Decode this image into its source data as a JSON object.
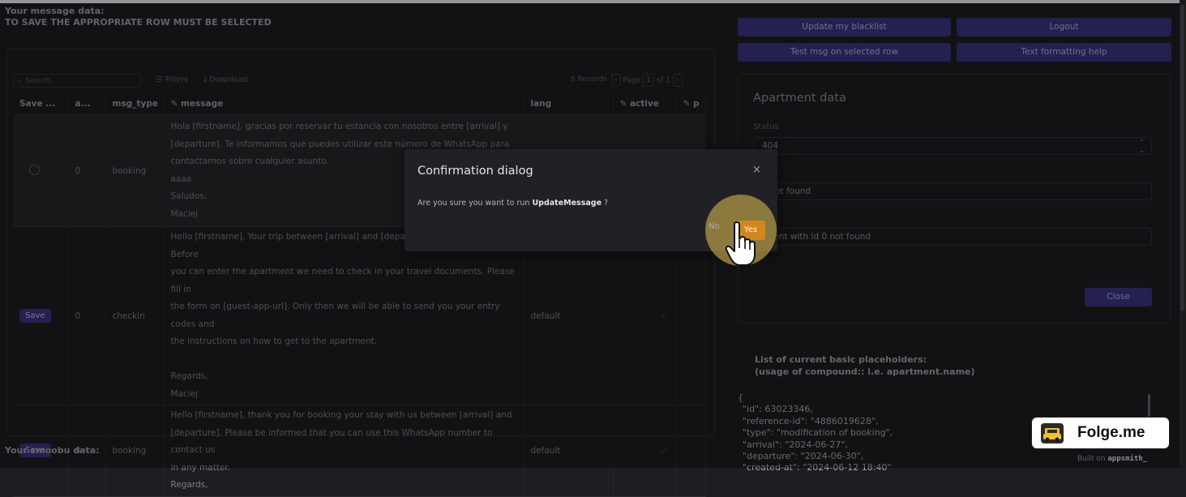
{
  "header": {
    "title": "Your message data:",
    "subtitle": "TO SAVE THE APPROPRIATE ROW MUST BE SELECTED",
    "bottom_title": "Your smoobu data:"
  },
  "table_toolbar": {
    "search_placeholder": "Search...",
    "filters": "Filters",
    "download": "Download",
    "records": "6 Records",
    "page_label": "Page",
    "page": "1",
    "of": "of 1"
  },
  "table": {
    "columns": [
      "Save ...",
      "a...",
      "msg_type",
      "message",
      "lang",
      "active",
      "p"
    ],
    "save_label": "Save",
    "rows": [
      {
        "a": "0",
        "msg_type": "booking",
        "message": [
          "Hola [firstname], gracias por reservar tu estancia con nosotros entre [arrival] y",
          "[departure]. Te informamos que puedes utilizar este número de WhatsApp para",
          "contactarnos sobre cualquier asunto.",
          "aaaa",
          "Saludos,",
          "Maciej"
        ],
        "lang": ""
      },
      {
        "a": "0",
        "msg_type": "checkin",
        "message": [
          "Hello [firstname], Your trip between [arrival] and [departure] is approaching. Before",
          "you can enter the apartment we need to check in your travel documents. Please fill in",
          "the form on [guest-app-url]. Only then we will be able to send you your entry codes and",
          "the instructions on how to get to the apartment.",
          "",
          "Regards,",
          "Maciej"
        ],
        "lang": "default"
      },
      {
        "a": "0",
        "msg_type": "booking",
        "message": [
          "Hello [firstname], thank you for booking your stay with us between [arrival] and",
          "[departure]. Please be informed that you can use this WhatsApp number to contact us",
          "in any matter.",
          "Regards,"
        ],
        "lang": "default"
      }
    ]
  },
  "buttons": {
    "update_blacklist": "Update my blacklist",
    "logout": "Logout",
    "test_msg": "Test msg on selected row",
    "text_help": "Text formatting help"
  },
  "apartment": {
    "title": "Apartment data",
    "status_label": "Status",
    "status_value": "404",
    "field2_value": "y not found",
    "field3_value": "tment with id 0 not found",
    "close": "Close"
  },
  "placeholders": {
    "title": "List of current basic placeholders:",
    "subtitle": "(usage of compound:: i.e. apartment.name)",
    "json_lines": [
      "{",
      "\"id\": 63023346,",
      "\"reference-id\": \"4886019628\",",
      "\"type\": \"modification of booking\",",
      "\"arrival\": \"2024-06-27\",",
      "\"departure\": \"2024-06-30\",",
      "\"created-at\": \"2024-06-12 18:40\""
    ]
  },
  "dialog": {
    "title": "Confirmation dialog",
    "text_prefix": "Are you sure you want to run",
    "action": "UpdateMessage",
    "text_suffix": " ?",
    "no": "No",
    "yes": "Yes",
    "close_glyph": "×"
  },
  "branding": {
    "folge": "Folge.me",
    "built_on": "Built on",
    "appsmith": "appsmith_"
  }
}
